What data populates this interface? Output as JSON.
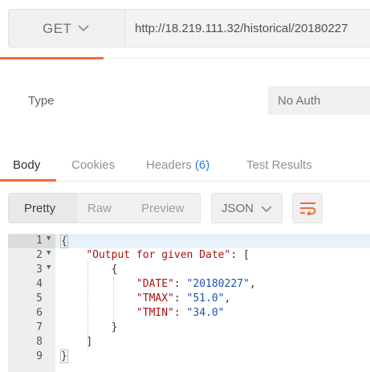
{
  "request": {
    "method": "GET",
    "url": "http://18.219.111.32/historical/20180227"
  },
  "auth": {
    "type_label": "Type",
    "type_value": "No Auth"
  },
  "response_tabs": [
    {
      "label": "Body",
      "active": true
    },
    {
      "label": "Cookies",
      "active": false
    },
    {
      "label": "Headers",
      "count": "(6)",
      "active": false
    },
    {
      "label": "Test Results",
      "active": false
    }
  ],
  "view_modes": [
    {
      "label": "Pretty",
      "active": true
    },
    {
      "label": "Raw",
      "active": false
    },
    {
      "label": "Preview",
      "active": false
    }
  ],
  "format": "JSON",
  "icons": {
    "method_dropdown": "chevron-down-icon",
    "format_dropdown": "chevron-down-icon",
    "wrap": "wrap-lines-icon"
  },
  "colors": {
    "accent": "#f26b3a",
    "count": "#2a7bd2",
    "json_key": "#a31515",
    "json_string": "#1f4fb0"
  },
  "editor": {
    "lines": [
      {
        "num": "1",
        "fold": true,
        "active": true,
        "key": "",
        "value": "",
        "text": "{"
      },
      {
        "num": "2",
        "fold": true,
        "key": "\"Output for given Date\"",
        "after_key": ": [",
        "value": ""
      },
      {
        "num": "3",
        "fold": true,
        "text": "{"
      },
      {
        "num": "4",
        "key": "\"DATE\"",
        "after_key": ": ",
        "value": "\"20180227\"",
        "tail": ","
      },
      {
        "num": "5",
        "key": "\"TMAX\"",
        "after_key": ": ",
        "value": "\"51.0\"",
        "tail": ","
      },
      {
        "num": "6",
        "key": "\"TMIN\"",
        "after_key": ": ",
        "value": "\"34.0\"",
        "tail": ""
      },
      {
        "num": "7",
        "text": "}"
      },
      {
        "num": "8",
        "text": "]"
      },
      {
        "num": "9",
        "text": "}"
      }
    ]
  }
}
